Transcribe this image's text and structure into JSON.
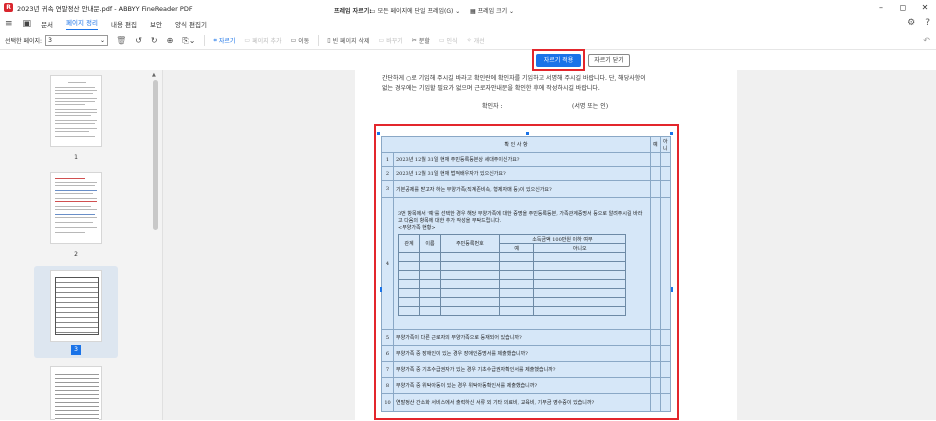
{
  "window": {
    "title": "2023년 귀속 연말정산 안내문.pdf - ABBYY FineReader PDF",
    "app_icon_letter": "R",
    "controls": [
      "–",
      "◻",
      "✕"
    ]
  },
  "menu": {
    "items": [
      "문서",
      "페이지 정리",
      "내용 편집",
      "보안",
      "양식 편집기"
    ],
    "active": "페이지 정리"
  },
  "toolbar": {
    "select_label": "선택한 페이지:",
    "select_value": "3",
    "crop": "자르기",
    "add_page": "페이지 추가",
    "replace": "이동",
    "blank_delete": "빈 페이지 삭제",
    "background": "바꾸기",
    "split": "분할",
    "ocr": "인식",
    "redact": "개선"
  },
  "cropbar": {
    "label": "프레임 자르기:",
    "all_pages": "모든 페이지에 단일 프레임(G)",
    "frame_size": "프레임 크기",
    "apply": "자르기 적용",
    "close": "자르기 닫기"
  },
  "thumbnails": [
    {
      "num": "1"
    },
    {
      "num": "2"
    },
    {
      "num": "3"
    }
  ],
  "document": {
    "line1": "간단하게 ○로 기입해 주시길 바라고 확인란에 확인자를 기입하고 서명해 주시길 바랍니다. 단, 해당사항이",
    "line2": "없는 경우에는 기입할 필요가 없으며 근로자안내문을 확인한 후에 작성하시길 바랍니다.",
    "confirmer": "확인자 :",
    "sign": "(서명 또는 인)",
    "table": {
      "header": "확 인 사 항",
      "yes": "예",
      "no": "아니",
      "rows": [
        {
          "num": "1",
          "text": "2023년 12월 31일 현재 주민등록등본상 세대주이신가요?"
        },
        {
          "num": "2",
          "text": "2023년 12월 31일 현재 법적배우자가 있으신가요?"
        },
        {
          "num": "3",
          "text": "기본공제를 받고자 하는 부양가족(직계존비속, 형제자매 등)이 있으신가요?"
        }
      ],
      "row4": {
        "num": "4",
        "text": "3번 항목에서 '예'를 선택한 경우 해당 부양가족에 대한 증명을 주민등록등본, 가족관계증명서 등으로 알려주시길 바라고 다음의 항목에 대한 추가 작성을 부탁드립니다.",
        "sub": "<부양가족 현황>",
        "cols": [
          "관계",
          "이름",
          "주민등록번호",
          "소득금액 100만원 이하 여부"
        ],
        "yn": [
          "예",
          "아니오"
        ]
      },
      "rows_after": [
        {
          "num": "5",
          "text": "부양가족이 다른 근로자의 부양가족으로 등재되어 있습니까?"
        },
        {
          "num": "6",
          "text": "부양가족 중 장애인이 있는 경우 장애인증명서를 제출했습니까?"
        },
        {
          "num": "7",
          "text": "부양가족 중 기초수급권자가 있는 경우 기초수급권자확인서를 제출했습니까?"
        },
        {
          "num": "8",
          "text": "부양가족 중 위탁아동이 있는 경우 위탁아동확인서를 제출했습니까?"
        },
        {
          "num": "10",
          "text": "연말정산 간소화 서비스에서 출력하신 서류 외 기타 의료비, 교육비, 기부금 영수증이 있습니까?"
        }
      ]
    }
  },
  "colors": {
    "accent": "#1a73e8",
    "highlight": "#e3262c",
    "table_bg": "#d6e7f8"
  }
}
